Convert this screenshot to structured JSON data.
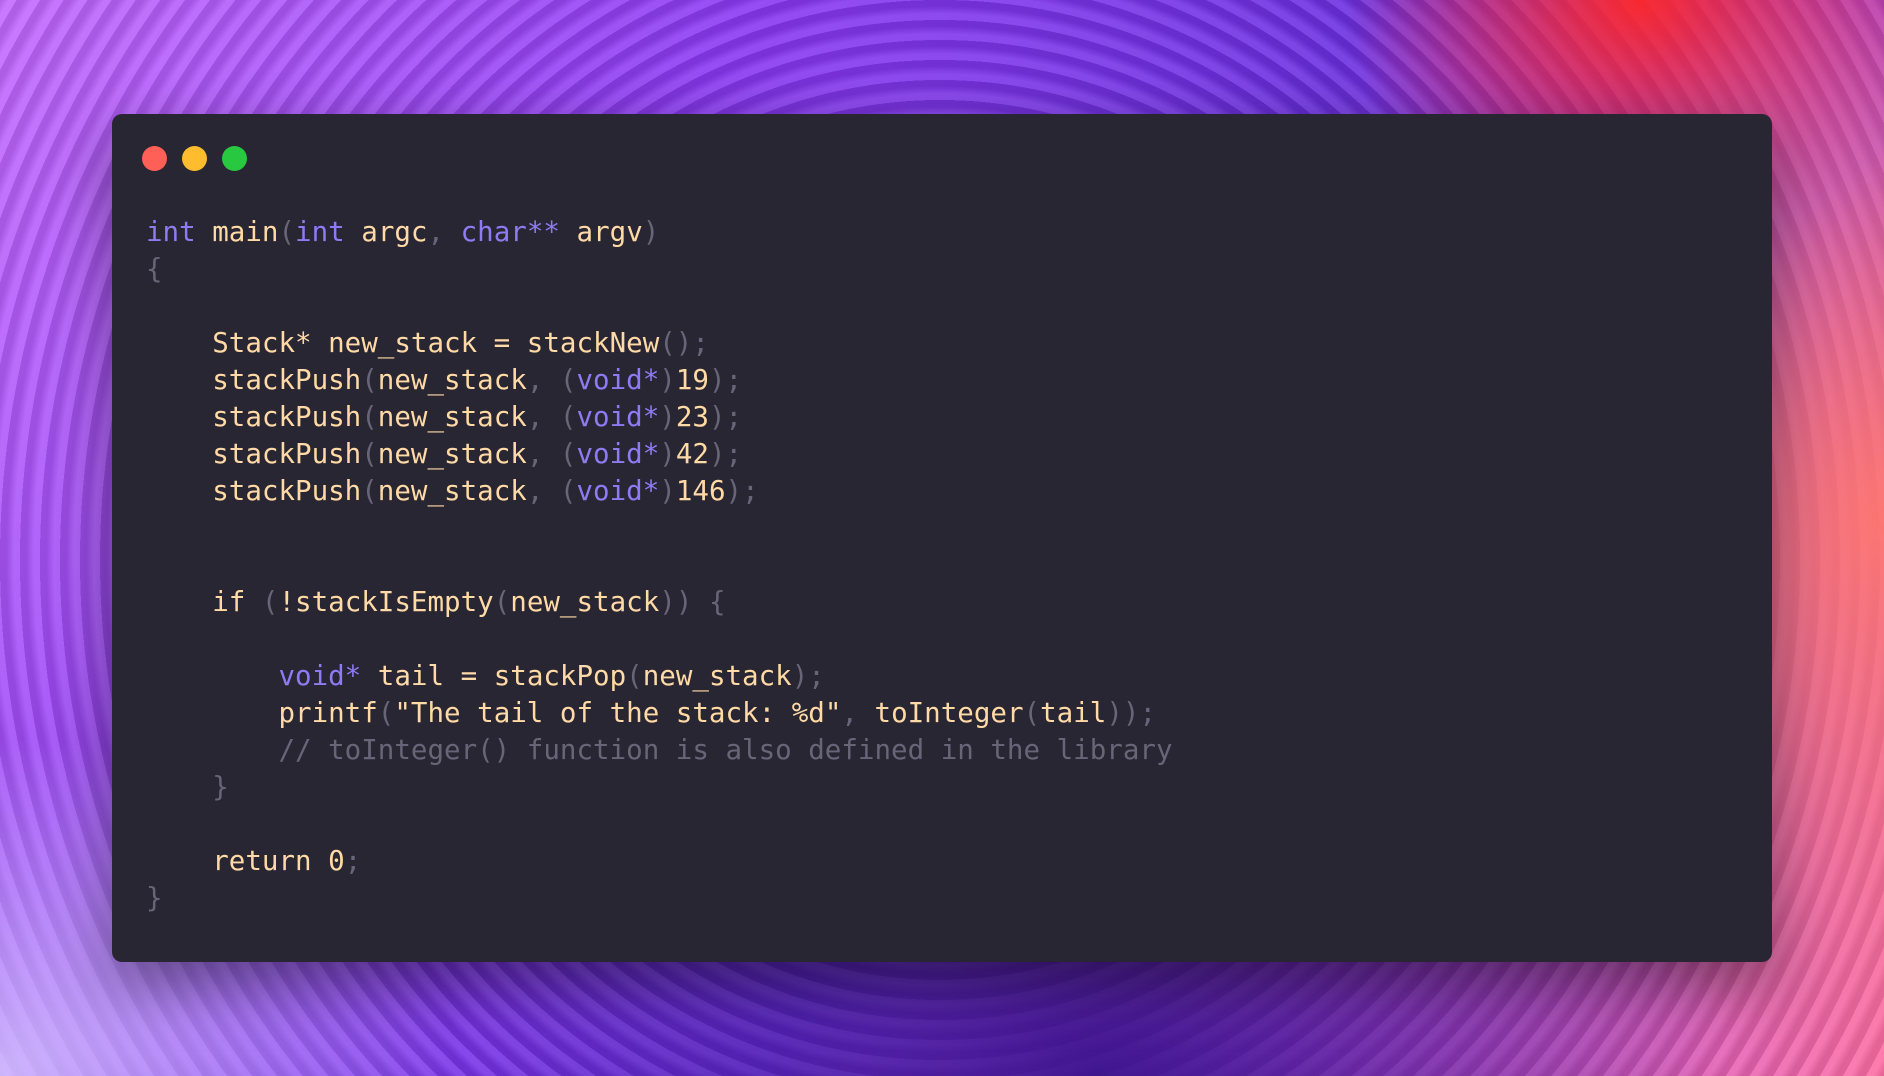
{
  "window": {
    "controls": [
      {
        "name": "close",
        "color": "#fe5f57"
      },
      {
        "name": "minimize",
        "color": "#febc2e"
      },
      {
        "name": "zoom",
        "color": "#28c840"
      }
    ]
  },
  "colors": {
    "editor_background": "#282632",
    "keyword": "#8e7bf3",
    "identifier": "#ffd9a6",
    "punctuation": "#676577",
    "comment": "#676577"
  },
  "code": {
    "language": "c",
    "lines": [
      [
        {
          "t": "int",
          "c": "kw"
        },
        {
          "t": " ",
          "c": "plain"
        },
        {
          "t": "main",
          "c": "fn"
        },
        {
          "t": "(",
          "c": "punct"
        },
        {
          "t": "int",
          "c": "kw"
        },
        {
          "t": " argc",
          "c": "plain"
        },
        {
          "t": ", ",
          "c": "punct"
        },
        {
          "t": "char**",
          "c": "kw"
        },
        {
          "t": " argv",
          "c": "plain"
        },
        {
          "t": ")",
          "c": "punct"
        }
      ],
      [
        {
          "t": "{",
          "c": "punct"
        }
      ],
      [],
      [
        {
          "t": "    Stack* new_stack = stackNew",
          "c": "plain"
        },
        {
          "t": "();",
          "c": "punct"
        }
      ],
      [
        {
          "t": "    stackPush",
          "c": "fn"
        },
        {
          "t": "(",
          "c": "punct"
        },
        {
          "t": "new_stack",
          "c": "plain"
        },
        {
          "t": ", (",
          "c": "punct"
        },
        {
          "t": "void*",
          "c": "kw"
        },
        {
          "t": ")",
          "c": "punct"
        },
        {
          "t": "19",
          "c": "num"
        },
        {
          "t": ");",
          "c": "punct"
        }
      ],
      [
        {
          "t": "    stackPush",
          "c": "fn"
        },
        {
          "t": "(",
          "c": "punct"
        },
        {
          "t": "new_stack",
          "c": "plain"
        },
        {
          "t": ", (",
          "c": "punct"
        },
        {
          "t": "void*",
          "c": "kw"
        },
        {
          "t": ")",
          "c": "punct"
        },
        {
          "t": "23",
          "c": "num"
        },
        {
          "t": ");",
          "c": "punct"
        }
      ],
      [
        {
          "t": "    stackPush",
          "c": "fn"
        },
        {
          "t": "(",
          "c": "punct"
        },
        {
          "t": "new_stack",
          "c": "plain"
        },
        {
          "t": ", (",
          "c": "punct"
        },
        {
          "t": "void*",
          "c": "kw"
        },
        {
          "t": ")",
          "c": "punct"
        },
        {
          "t": "42",
          "c": "num"
        },
        {
          "t": ");",
          "c": "punct"
        }
      ],
      [
        {
          "t": "    stackPush",
          "c": "fn"
        },
        {
          "t": "(",
          "c": "punct"
        },
        {
          "t": "new_stack",
          "c": "plain"
        },
        {
          "t": ", (",
          "c": "punct"
        },
        {
          "t": "void*",
          "c": "kw"
        },
        {
          "t": ")",
          "c": "punct"
        },
        {
          "t": "146",
          "c": "num"
        },
        {
          "t": ");",
          "c": "punct"
        }
      ],
      [],
      [],
      [
        {
          "t": "    if",
          "c": "plain"
        },
        {
          "t": " (",
          "c": "punct"
        },
        {
          "t": "!stackIsEmpty",
          "c": "fn"
        },
        {
          "t": "(",
          "c": "punct"
        },
        {
          "t": "new_stack",
          "c": "plain"
        },
        {
          "t": ")) {",
          "c": "punct"
        }
      ],
      [],
      [
        {
          "t": "        ",
          "c": "plain"
        },
        {
          "t": "void*",
          "c": "kw"
        },
        {
          "t": " tail = stackPop",
          "c": "plain"
        },
        {
          "t": "(",
          "c": "punct"
        },
        {
          "t": "new_stack",
          "c": "plain"
        },
        {
          "t": ");",
          "c": "punct"
        }
      ],
      [
        {
          "t": "        printf",
          "c": "fn"
        },
        {
          "t": "(",
          "c": "punct"
        },
        {
          "t": "\"The tail of the stack: %d\"",
          "c": "str"
        },
        {
          "t": ", ",
          "c": "punct"
        },
        {
          "t": "toInteger",
          "c": "fn"
        },
        {
          "t": "(",
          "c": "punct"
        },
        {
          "t": "tail",
          "c": "plain"
        },
        {
          "t": "));",
          "c": "punct"
        }
      ],
      [
        {
          "t": "        // toInteger() function is also defined in the library",
          "c": "comment"
        }
      ],
      [
        {
          "t": "    }",
          "c": "punct"
        }
      ],
      [],
      [
        {
          "t": "    return ",
          "c": "plain"
        },
        {
          "t": "0",
          "c": "num"
        },
        {
          "t": ";",
          "c": "punct"
        }
      ],
      [
        {
          "t": "}",
          "c": "punct"
        }
      ]
    ]
  }
}
